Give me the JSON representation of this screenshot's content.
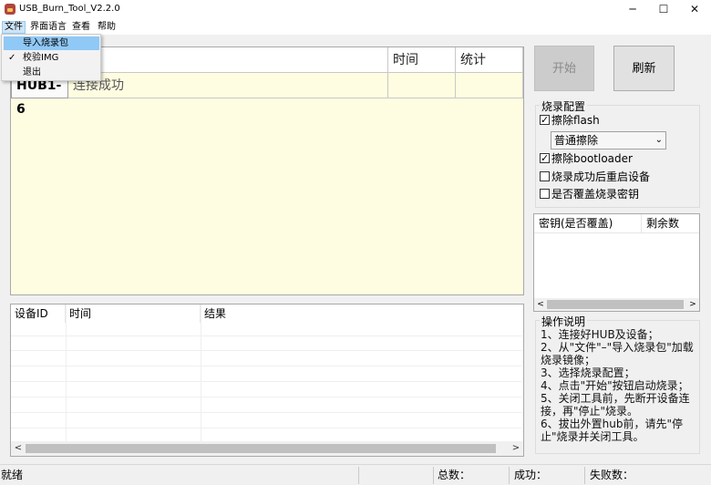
{
  "window": {
    "title": "USB_Burn_Tool_V2.2.0",
    "controls": {
      "minimize": "─",
      "maximize": "☐",
      "close": "✕"
    }
  },
  "menubar": {
    "items": [
      "文件",
      "界面语言",
      "查看",
      "帮助"
    ]
  },
  "file_menu": {
    "items": [
      {
        "label": "导入烧录包",
        "checked": false,
        "highlighted": true
      },
      {
        "label": "校验IMG",
        "checked": true,
        "highlighted": false
      },
      {
        "label": "退出",
        "checked": false,
        "highlighted": false
      }
    ],
    "check_glyph": "✓"
  },
  "device_table": {
    "headers": [
      "",
      "时间",
      "统计"
    ],
    "rows": [
      {
        "hub": "HUB1-6",
        "status": "连接成功",
        "time": "",
        "stats": ""
      }
    ]
  },
  "log_table": {
    "headers": [
      "设备ID",
      "时间",
      "结果"
    ],
    "scroll_left": "<",
    "scroll_right": ">"
  },
  "buttons": {
    "start": "开始",
    "refresh": "刷新"
  },
  "burn_config": {
    "title": "烧录配置",
    "erase_flash": {
      "label": "擦除flash",
      "checked": true
    },
    "erase_mode": "普通擦除",
    "erase_bootloader": {
      "label": "擦除bootloader",
      "checked": true
    },
    "restart_after": {
      "label": "烧录成功后重启设备",
      "checked": false
    },
    "overwrite_key": {
      "label": "是否覆盖烧录密钥",
      "checked": false
    }
  },
  "key_table": {
    "headers": [
      "密钥(是否覆盖)",
      "剩余数"
    ],
    "scroll_left": "<",
    "scroll_right": ">"
  },
  "instructions": {
    "title": "操作说明",
    "lines": [
      "1、连接好HUB及设备；",
      "2、从\"文件\"–\"导入烧录包\"加载烧录镜像；",
      "3、选择烧录配置；",
      "4、点击\"开始\"按钮启动烧录；",
      "5、关闭工具前，先断开设备连接，再\"停止\"烧录。",
      "6、拔出外置hub前，请先\"停止\"烧录并关闭工具。"
    ]
  },
  "statusbar": {
    "status": "就绪",
    "total_label": "总数：",
    "success_label": "成功：",
    "fail_label": "失败数："
  },
  "colors": {
    "device_panel_bg": "#fffde1",
    "menu_highlight": "#90c8f6",
    "menu_active": "#cce4f7"
  }
}
